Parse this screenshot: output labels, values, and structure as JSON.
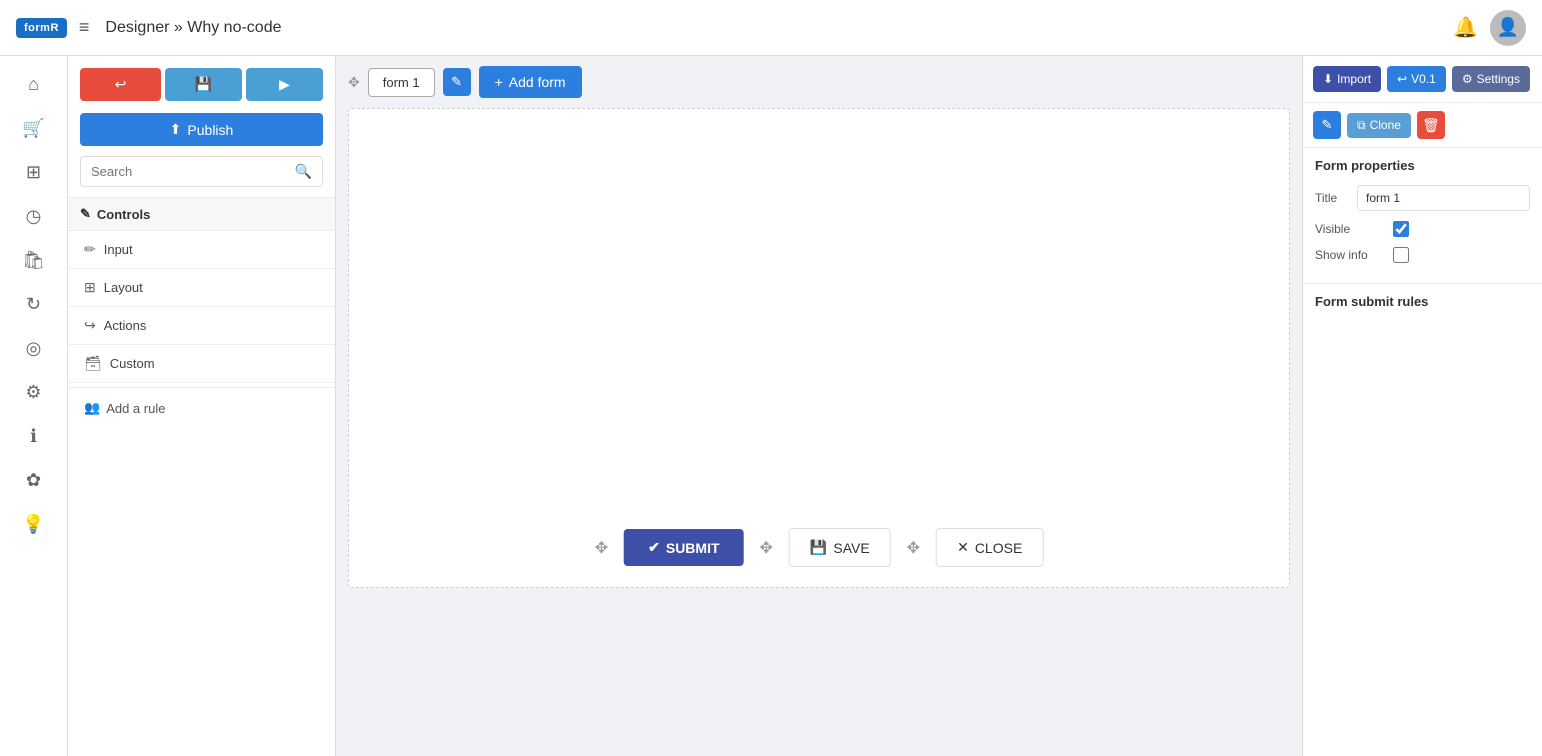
{
  "topbar": {
    "logo": "formR",
    "title": "Designer » Why no-code",
    "menu_label": "≡"
  },
  "left_sidebar": {
    "icons": [
      {
        "name": "home-icon",
        "symbol": "⌂"
      },
      {
        "name": "cart-icon",
        "symbol": "🛒"
      },
      {
        "name": "layers-icon",
        "symbol": "⊞"
      },
      {
        "name": "clock-icon",
        "symbol": "◷"
      },
      {
        "name": "bag-icon",
        "symbol": "🛍"
      },
      {
        "name": "refresh-icon",
        "symbol": "↻"
      },
      {
        "name": "gauge-icon",
        "symbol": "◎"
      },
      {
        "name": "gear-icon",
        "symbol": "⚙"
      },
      {
        "name": "info-icon",
        "symbol": "ℹ"
      },
      {
        "name": "wheel-icon",
        "symbol": "✿"
      },
      {
        "name": "bulb-icon",
        "symbol": "💡"
      }
    ]
  },
  "controls_panel": {
    "undo_label": "↩",
    "save_label": "💾",
    "play_label": "▶",
    "publish_label": "Publish",
    "search_placeholder": "Search",
    "controls_header": "Controls",
    "items": [
      {
        "icon": "✏",
        "label": "Input"
      },
      {
        "icon": "⊞",
        "label": "Layout"
      },
      {
        "icon": "↪",
        "label": "Actions"
      },
      {
        "icon": "🗃",
        "label": "Custom"
      }
    ],
    "add_rule_label": "Add a rule"
  },
  "canvas": {
    "form_tab_label": "form 1",
    "drag_symbol": "✥",
    "add_form_label": "Add form",
    "submit_label": "SUBMIT",
    "save_label": "SAVE",
    "close_label": "CLOSE"
  },
  "right_panel": {
    "import_label": "Import",
    "version_label": "V0.1",
    "settings_label": "Settings",
    "edit_label": "✎",
    "clone_label": "Clone",
    "delete_label": "🗑",
    "form_properties_title": "Form properties",
    "title_label": "Title",
    "title_value": "form 1",
    "visible_label": "Visible",
    "show_info_label": "Show info",
    "form_submit_rules_title": "Form submit rules"
  }
}
